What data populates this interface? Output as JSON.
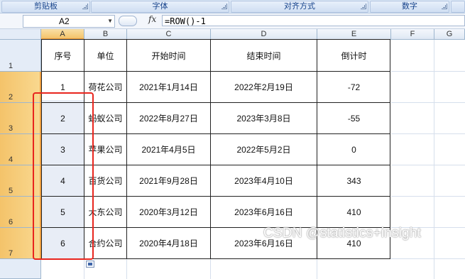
{
  "ribbon": {
    "groups": [
      "剪贴板",
      "字体",
      "对齐方式",
      "数字"
    ]
  },
  "formula_bar": {
    "name_box": "A2",
    "fx_label": "fx",
    "formula": "=ROW()-1"
  },
  "sheet": {
    "columns": [
      "A",
      "B",
      "C",
      "D",
      "E",
      "F",
      "G"
    ],
    "rows": [
      "1",
      "2",
      "3",
      "4",
      "5",
      "6",
      "7"
    ],
    "headers": [
      "序号",
      "单位",
      "开始时间",
      "结束时间",
      "倒计时"
    ],
    "data": [
      [
        "1",
        "荷花公司",
        "2021年1月14日",
        "2022年2月19日",
        "-72"
      ],
      [
        "2",
        "蚂蚁公司",
        "2022年8月27日",
        "2023年3月8日",
        "-55"
      ],
      [
        "3",
        "苹果公司",
        "2021年4月5日",
        "2022年5月2日",
        "0"
      ],
      [
        "4",
        "百货公司",
        "2021年9月28日",
        "2023年4月10日",
        "343"
      ],
      [
        "5",
        "大东公司",
        "2020年3月12日",
        "2023年6月16日",
        "410"
      ],
      [
        "6",
        "合约公司",
        "2020年4月18日",
        "2023年6月16日",
        "410"
      ]
    ]
  },
  "colors": {
    "highlight_box": "#e8251e",
    "selected_header": "#f4c36a"
  },
  "watermark": "CSDN @statistics+insight"
}
